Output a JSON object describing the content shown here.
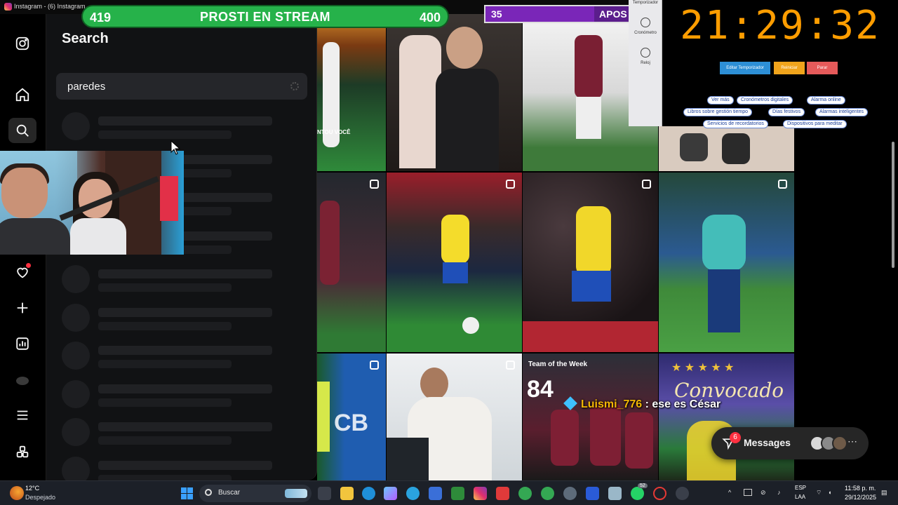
{
  "window": {
    "title": "Instagram - (6) Instagram"
  },
  "nav": {
    "items": [
      {
        "name": "instagram-logo-icon"
      },
      {
        "name": "home-icon"
      },
      {
        "name": "search-icon"
      },
      {
        "name": "explore-icon"
      },
      {
        "name": "reels-icon"
      },
      {
        "name": "messenger-icon"
      },
      {
        "name": "heart-icon"
      },
      {
        "name": "create-icon"
      },
      {
        "name": "dashboard-icon"
      },
      {
        "name": "profile-avatar"
      },
      {
        "name": "menu-icon"
      },
      {
        "name": "also-from-meta-icon"
      }
    ]
  },
  "search_panel": {
    "title": "Search",
    "query": "paredes",
    "loading_rows": 10
  },
  "stream_overlay": {
    "green_bar": {
      "left": "419",
      "center": "PROSTI EN STREAM",
      "right": "400"
    },
    "purple_bar": {
      "value": "35",
      "text": "APOS",
      "progress": 0.75
    }
  },
  "timer_widget": {
    "side": {
      "stopwatch": "Cronómetro",
      "clock": "Reloj",
      "top": "Temporizador"
    },
    "time": "21:29:32",
    "buttons": {
      "edit": "Editar Temporizador",
      "reset": "Reiniciar",
      "stop": "Parar"
    },
    "links": [
      "Ver más",
      "Cronómetros digitales",
      "Alarma online",
      "Libros sobre gestión tiempo",
      "Días festivos",
      "Alarmas inteligentes",
      "Servicios de recordatorios",
      "Dispositivos para meditar"
    ],
    "colors": {
      "digits": "#ff9d00",
      "edit": "#2d8fd6",
      "reset": "#f0a41c",
      "stop": "#e55a5a"
    }
  },
  "grid": {
    "tile_caption": "NTOU VOCÊ",
    "team_of_week": {
      "label": "Team of the Week",
      "rating": "84"
    }
  },
  "chat": {
    "user": "Luismi_776",
    "message": ": ese es César"
  },
  "convocado": {
    "text": "Convocado"
  },
  "messages_pill": {
    "label": "Messages",
    "count": "6"
  },
  "taskbar": {
    "weather": {
      "temp": "12°C",
      "status": "Despejado"
    },
    "search_placeholder": "Buscar",
    "whatsapp_badge": "52",
    "lang": {
      "line1": "ESP",
      "line2": "LAA"
    },
    "time": "11:58 p. m.",
    "date": "29/12/2025"
  }
}
